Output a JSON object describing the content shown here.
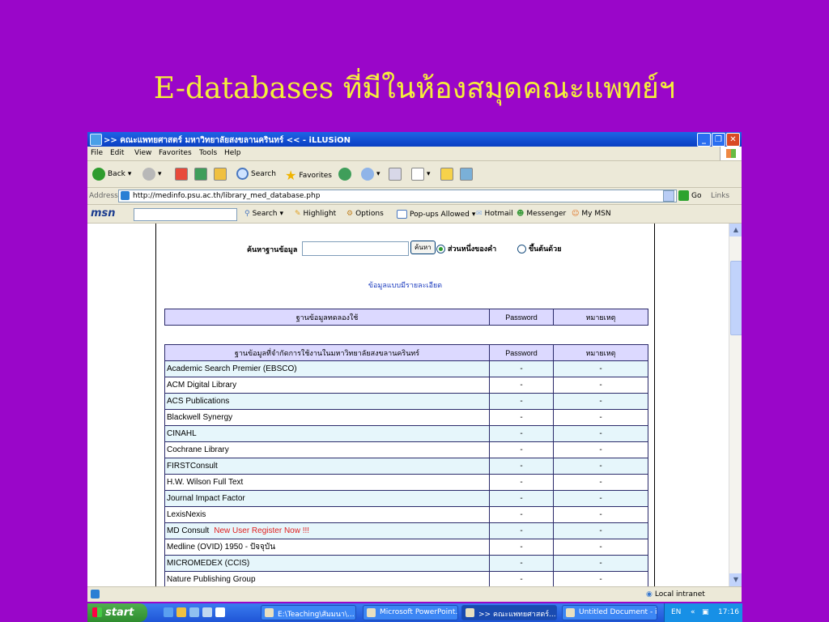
{
  "slide": {
    "title": "E-databases ที่มีในห้องสมุดคณะแพทย์ฯ"
  },
  "window": {
    "title": ">> คณะแพทยศาสตร์ มหาวิทยาลัยสงขลานครินทร์ << - iLLUSiON",
    "menu": [
      "File",
      "Edit",
      "View",
      "Favorites",
      "Tools",
      "Help"
    ]
  },
  "toolbar": {
    "back": "Back",
    "search": "Search",
    "favorites": "Favorites"
  },
  "address": {
    "label": "Address",
    "url": "http://medinfo.psu.ac.th/library_med_database.php",
    "go": "Go",
    "links": "Links"
  },
  "msn": {
    "logo": "msn",
    "search": "Search",
    "highlight": "Highlight",
    "options": "Options",
    "popups": "Pop-ups Allowed",
    "hotmail": "Hotmail",
    "messenger": "Messenger",
    "mymsn": "My MSN"
  },
  "page": {
    "search_label": "ค้นหาฐานข้อมูล",
    "search_value": "",
    "search_button": "ค้นหา",
    "radio_partial": "ส่วนหนึ่งของคำ",
    "radio_prefix": "ขึ้นต้นด้วย",
    "detail_link": "ข้อมูลแบบมีรายละเอียด",
    "trial_table": {
      "headers": [
        "ฐานข้อมูลทดลองใช้",
        "Password",
        "หมายเหตุ"
      ]
    },
    "licensed_table": {
      "headers": [
        "ฐานข้อมูลที่จำกัดการใช้งานในมหาวิทยาลัยสงขลานครินทร์",
        "Password",
        "หมายเหตุ"
      ],
      "rows": [
        {
          "name": "Academic Search Premier (EBSCO)",
          "password": "-",
          "note": "-"
        },
        {
          "name": "ACM Digital Library",
          "password": "-",
          "note": "-"
        },
        {
          "name": "ACS Publications",
          "password": "-",
          "note": "-"
        },
        {
          "name": "Blackwell Synergy",
          "password": "-",
          "note": "-"
        },
        {
          "name": "CINAHL",
          "password": "-",
          "note": "-"
        },
        {
          "name": "Cochrane Library",
          "password": "-",
          "note": "-"
        },
        {
          "name": "FIRSTConsult",
          "password": "-",
          "note": "-"
        },
        {
          "name": "H.W. Wilson Full Text",
          "password": "-",
          "note": "-"
        },
        {
          "name": "Journal Impact Factor",
          "password": "-",
          "note": "-"
        },
        {
          "name": "LexisNexis",
          "password": "-",
          "note": "-"
        },
        {
          "name": "MD Consult",
          "extra": "New User Register Now !!!",
          "password": "-",
          "note": "-"
        },
        {
          "name": "Medline (OVID) 1950 - ปัจจุบัน",
          "password": "-",
          "note": "-"
        },
        {
          "name": "MICROMEDEX (CCIS)",
          "password": "-",
          "note": "-"
        },
        {
          "name": "Nature Publishing Group",
          "password": "-",
          "note": "-"
        }
      ]
    }
  },
  "status": {
    "zone": "Local intranet"
  },
  "taskbar": {
    "start": "start",
    "tasks": [
      {
        "label": "E:\\Teaching\\สัมมนา\\...",
        "active": false
      },
      {
        "label": "Microsoft PowerPoint...",
        "active": false
      },
      {
        "label": ">> คณะแพทยศาสตร์...",
        "active": true
      },
      {
        "label": "Untitled Document - i...",
        "active": false
      }
    ],
    "lang": "EN",
    "clock": "17:16"
  }
}
